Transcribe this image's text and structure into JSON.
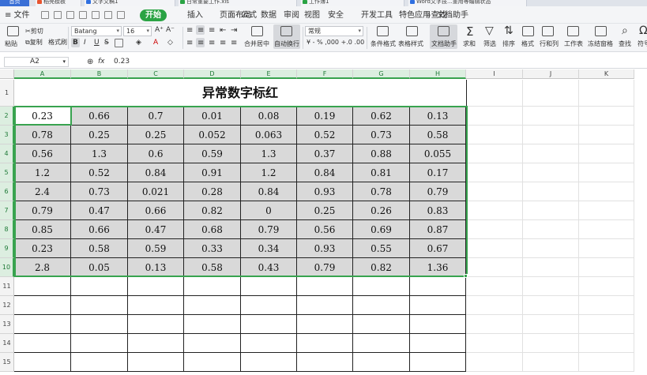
{
  "tabs": [
    {
      "label": "首页",
      "kind": "home",
      "icon": ""
    },
    {
      "label": "稻壳模板",
      "kind": "doc",
      "icon": "#e8542f"
    },
    {
      "label": "文字文稿1",
      "kind": "doc",
      "icon": "#2f6fe0"
    },
    {
      "label": "日常重要工作.xls",
      "kind": "doc",
      "icon": "#2aa344"
    },
    {
      "label": "工作簿1",
      "kind": "doc",
      "icon": "#2aa344"
    },
    {
      "label": "Word文字技...重用等编辑状态",
      "kind": "doc",
      "icon": "#2f6fe0"
    }
  ],
  "menu": {
    "file_label": "≡ 文件",
    "items": [
      "开始",
      "插入",
      "页面布局",
      "公式",
      "数据",
      "审阅",
      "视图",
      "安全",
      "开发工具",
      "特色应用",
      "文档助手"
    ],
    "active_index": 0,
    "search_label": "查找"
  },
  "toolbar": {
    "paste": "粘贴",
    "cut": "剪切",
    "copy": "复制",
    "format_painter": "格式刷",
    "font_name": "Batang",
    "font_size": "16",
    "merge_center": "合并居中",
    "wrap_text": "自动换行",
    "number_format": "常规",
    "percent_glyphs": "¥ - % ,000 +.0 .00",
    "conditional_format": "条件格式",
    "table_style": "表格样式",
    "doc_helper": "文档助手",
    "sum": "求和",
    "filter": "筛选",
    "sort": "排序",
    "format": "格式",
    "rows_cols": "行和列",
    "worksheet": "工作表",
    "freeze": "冻结窗格",
    "find": "查找",
    "symbol": "符号"
  },
  "formula_bar": {
    "cell_ref": "A2",
    "fx_label": "fx",
    "value": "0.23"
  },
  "sheet": {
    "columns": [
      "A",
      "B",
      "C",
      "D",
      "E",
      "F",
      "G",
      "H",
      "I",
      "J",
      "K"
    ],
    "selected_columns": [
      "A",
      "B",
      "C",
      "D",
      "E",
      "F",
      "G",
      "H"
    ],
    "row_numbers": [
      "1",
      "2",
      "3",
      "4",
      "5",
      "6",
      "7",
      "8",
      "9",
      "10",
      "11",
      "12",
      "13",
      "14",
      "15"
    ],
    "selected_rows": [
      "2",
      "3",
      "4",
      "5",
      "6",
      "7",
      "8",
      "9",
      "10"
    ],
    "title": "异常数字标红",
    "active_cell": "A2",
    "data": [
      [
        "0.23",
        "0.66",
        "0.7",
        "0.01",
        "0.08",
        "0.19",
        "0.62",
        "0.13"
      ],
      [
        "0.78",
        "0.25",
        "0.25",
        "0.052",
        "0.063",
        "0.52",
        "0.73",
        "0.58"
      ],
      [
        "0.56",
        "1.3",
        "0.6",
        "0.59",
        "1.3",
        "0.37",
        "0.88",
        "0.055"
      ],
      [
        "1.2",
        "0.52",
        "0.84",
        "0.91",
        "1.2",
        "0.84",
        "0.81",
        "0.17"
      ],
      [
        "2.4",
        "0.73",
        "0.021",
        "0.28",
        "0.84",
        "0.93",
        "0.78",
        "0.79"
      ],
      [
        "0.79",
        "0.47",
        "0.66",
        "0.82",
        "0",
        "0.25",
        "0.26",
        "0.83"
      ],
      [
        "0.85",
        "0.66",
        "0.47",
        "0.68",
        "0.79",
        "0.56",
        "0.69",
        "0.87"
      ],
      [
        "0.23",
        "0.58",
        "0.59",
        "0.33",
        "0.34",
        "0.93",
        "0.55",
        "0.67"
      ],
      [
        "2.8",
        "0.05",
        "0.13",
        "0.58",
        "0.43",
        "0.79",
        "0.82",
        "1.36"
      ]
    ]
  },
  "colors": {
    "accent_green": "#2aa344",
    "selection_green": "#38a34f",
    "data_fill": "#d9d9d9",
    "home_tab_blue": "#3a6fd6"
  }
}
